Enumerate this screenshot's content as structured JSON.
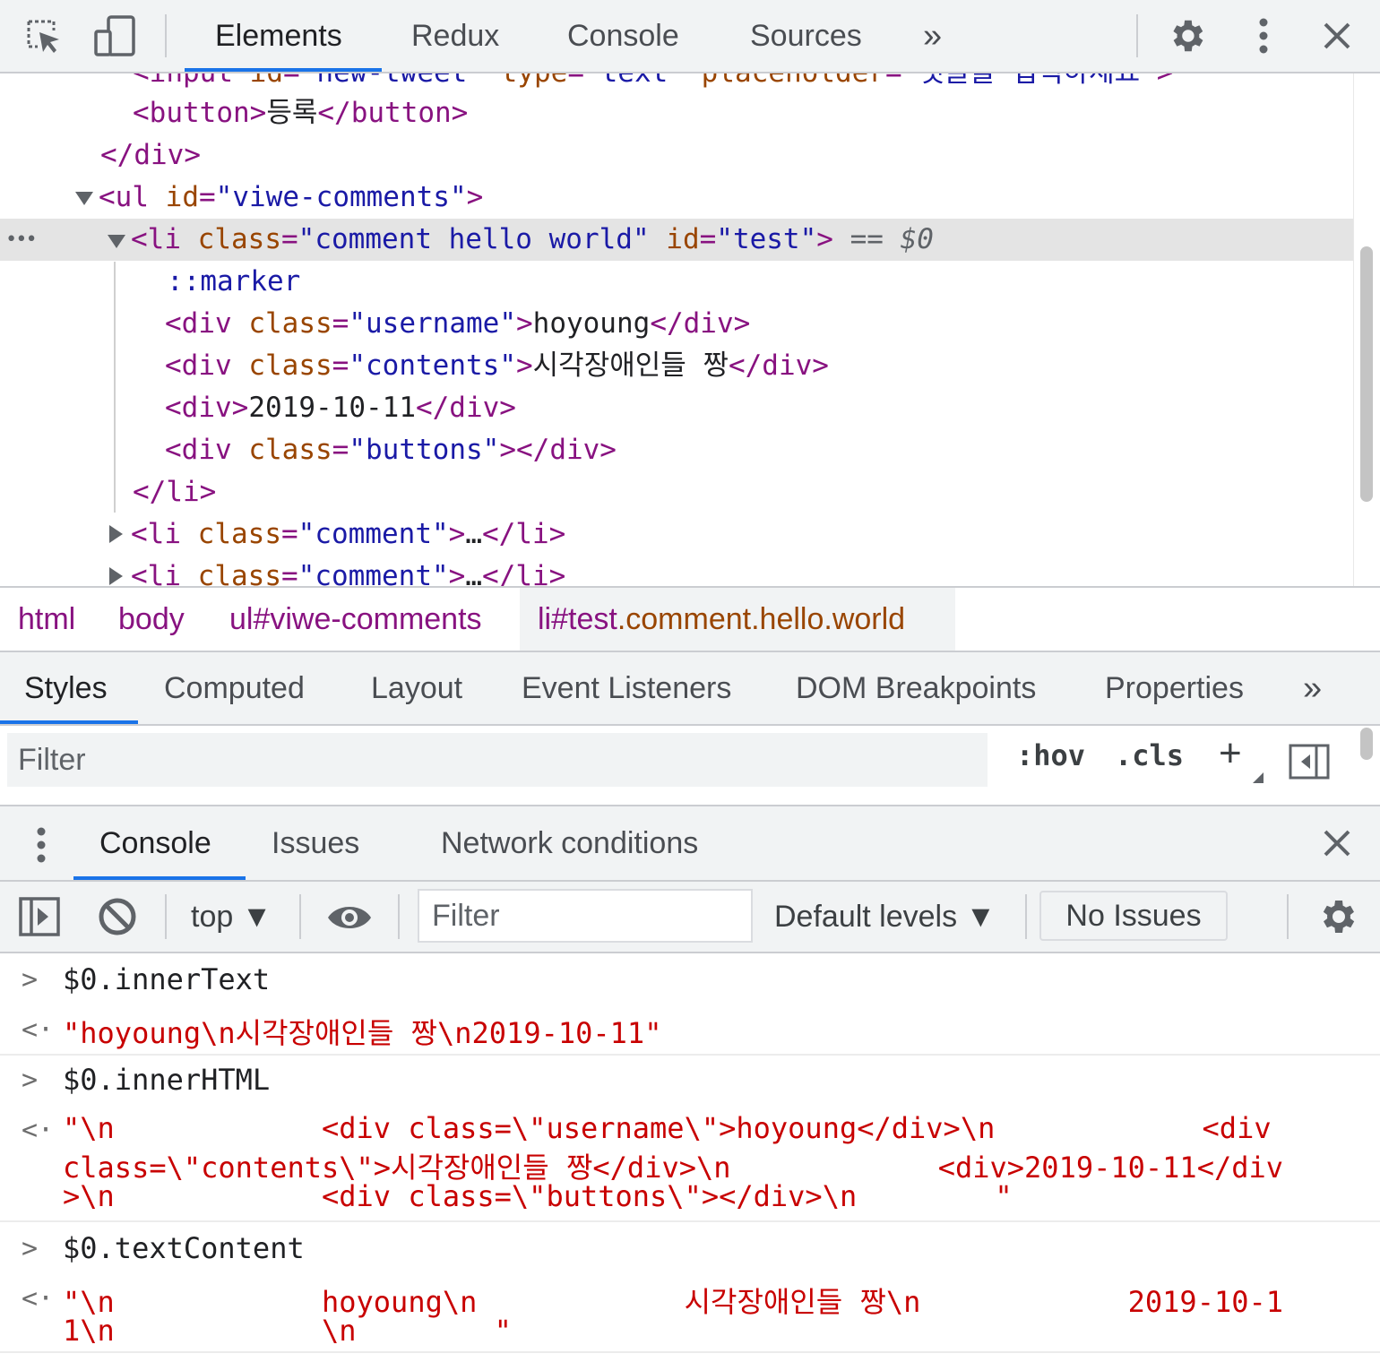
{
  "toolbar": {
    "tabs": [
      "Elements",
      "Redux",
      "Console",
      "Sources"
    ],
    "more": "»",
    "icons": [
      "inspect-icon",
      "device-toggle-icon",
      "gear-icon",
      "kebab-menu-icon",
      "close-icon"
    ]
  },
  "tree": {
    "line0": {
      "open": "<",
      "tag": "input",
      "a1": "id",
      "v1": "\"new-tweet\"",
      "a2": "type",
      "v2": "\"text\"",
      "a3": "placeholder",
      "v3": "\"댓글을 입력하세요\"",
      "close": ">"
    },
    "line1": {
      "open": "<",
      "tag": "button",
      "mid": ">",
      "text": "등록",
      "endtag": "</button>"
    },
    "line2": {
      "endtag": "</div>"
    },
    "line3": {
      "open": "<",
      "tag": "ul",
      "a1": "id",
      "v1": "\"viwe-comments\"",
      "close": ">"
    },
    "line4": {
      "ellipsis": "•••",
      "open": "<",
      "tag": "li",
      "a1": "class",
      "v1": "\"comment hello world\"",
      "a2": "id",
      "v2": "\"test\"",
      "close": ">",
      "eq": "==",
      "dollar": "$0"
    },
    "line5": {
      "text": "::marker"
    },
    "line6": {
      "open": "<",
      "tag": "div",
      "a1": "class",
      "v1": "\"username\"",
      "mid": ">",
      "text": "hoyoung",
      "endtag": "</div>"
    },
    "line7": {
      "open": "<",
      "tag": "div",
      "a1": "class",
      "v1": "\"contents\"",
      "mid": ">",
      "text": "시각장애인들 짱",
      "endtag": "</div>"
    },
    "line8": {
      "open": "<",
      "tag": "div",
      "mid": ">",
      "text": "2019-10-11",
      "endtag": "</div>"
    },
    "line9": {
      "open": "<",
      "tag": "div",
      "a1": "class",
      "v1": "\"buttons\"",
      "mid": "></div>"
    },
    "line10": {
      "endtag": "</li>"
    },
    "line11": {
      "open": "<",
      "tag": "li",
      "a1": "class",
      "v1": "\"comment\"",
      "mid": ">",
      "text": "…",
      "endtag": "</li>"
    },
    "line12": {
      "open": "<",
      "tag": "li",
      "a1": "class",
      "v1": "\"comment\"",
      "mid": ">",
      "text": "…",
      "endtag": "</li>"
    }
  },
  "breadcrumbs": {
    "html": "html",
    "body": "body",
    "ul": "ul#viwe-comments",
    "li_id": "li#test",
    "li_cls": ".comment.hello.world"
  },
  "subtabs": [
    "Styles",
    "Computed",
    "Layout",
    "Event Listeners",
    "DOM Breakpoints",
    "Properties"
  ],
  "subtabs_more": "»",
  "styles_filter": {
    "placeholder": "Filter",
    "hov": ":hov",
    "cls": ".cls",
    "plus": "+"
  },
  "drawer": {
    "tabs": [
      "Console",
      "Issues",
      "Network conditions"
    ]
  },
  "console_toolbar": {
    "context": "top ▼",
    "filter_placeholder": "Filter",
    "levels": "Default levels ▼",
    "issues": "No Issues"
  },
  "console": {
    "prompt_in": ">",
    "prompt_out": "<·",
    "m1_in": "$0.innerText",
    "m1_out": "\"hoyoung\\n시각장애인들 짱\\n2019-10-11\"",
    "m2_in": "$0.innerHTML",
    "m2_out_l1": "\"\\n            <div class=\\\"username\\\">hoyoung</div>\\n            <div",
    "m2_out_l2": "class=\\\"contents\\\">시각장애인들 짱</div>\\n            <div>2019-10-11</div",
    "m2_out_l3": ">\\n            <div class=\\\"buttons\\\"></div>\\n        \"",
    "m3_in": "$0.textContent",
    "m3_out_l1": "\"\\n            hoyoung\\n            시각장애인들 짱\\n            2019-10-1",
    "m3_out_l2": "1\\n            \\n        \""
  }
}
